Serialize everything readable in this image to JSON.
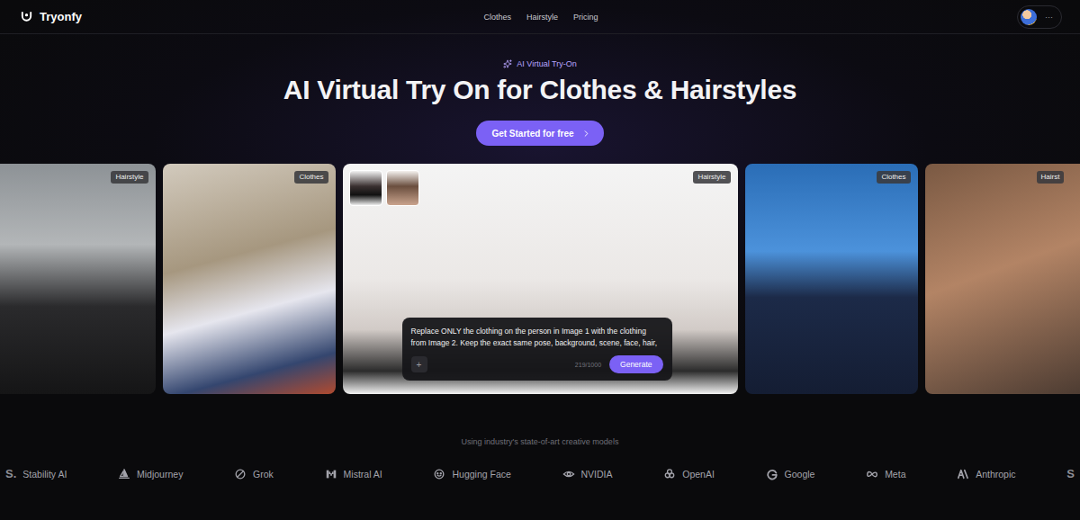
{
  "header": {
    "brand": "Tryonfy",
    "nav": [
      {
        "label": "Clothes"
      },
      {
        "label": "Hairstyle"
      },
      {
        "label": "Pricing"
      }
    ],
    "menu": "···"
  },
  "hero": {
    "badge": "AI Virtual Try-On",
    "title": "AI Virtual Try On for Clothes & Hairstyles",
    "cta": "Get Started for free"
  },
  "cards": [
    {
      "tag": "Hairstyle",
      "kind": "photo"
    },
    {
      "tag": "Clothes",
      "kind": "photo"
    },
    {
      "tag": "Hairstyle",
      "kind": "editor"
    },
    {
      "tag": "Clothes",
      "kind": "photo"
    },
    {
      "tag": "Hairst",
      "kind": "photo"
    }
  ],
  "editor": {
    "prompt": "Replace ONLY the clothing on the person in Image 1 with the clothing from Image 2. Keep the exact same pose, background, scene, face, hair,",
    "count": "219/1000",
    "add": "+",
    "generate": "Generate"
  },
  "models": {
    "caption": "Using industry's state-of-art creative models",
    "logos": [
      {
        "mark": "S.",
        "name": "Stability AI"
      },
      {
        "name": "Midjourney"
      },
      {
        "name": "Grok"
      },
      {
        "name": "Mistral AI"
      },
      {
        "name": "Hugging Face"
      },
      {
        "name": "NVIDIA"
      },
      {
        "name": "OpenAI"
      },
      {
        "name": "Google"
      },
      {
        "name": "Meta"
      },
      {
        "name": "Anthropic"
      },
      {
        "mark": "S"
      }
    ]
  }
}
